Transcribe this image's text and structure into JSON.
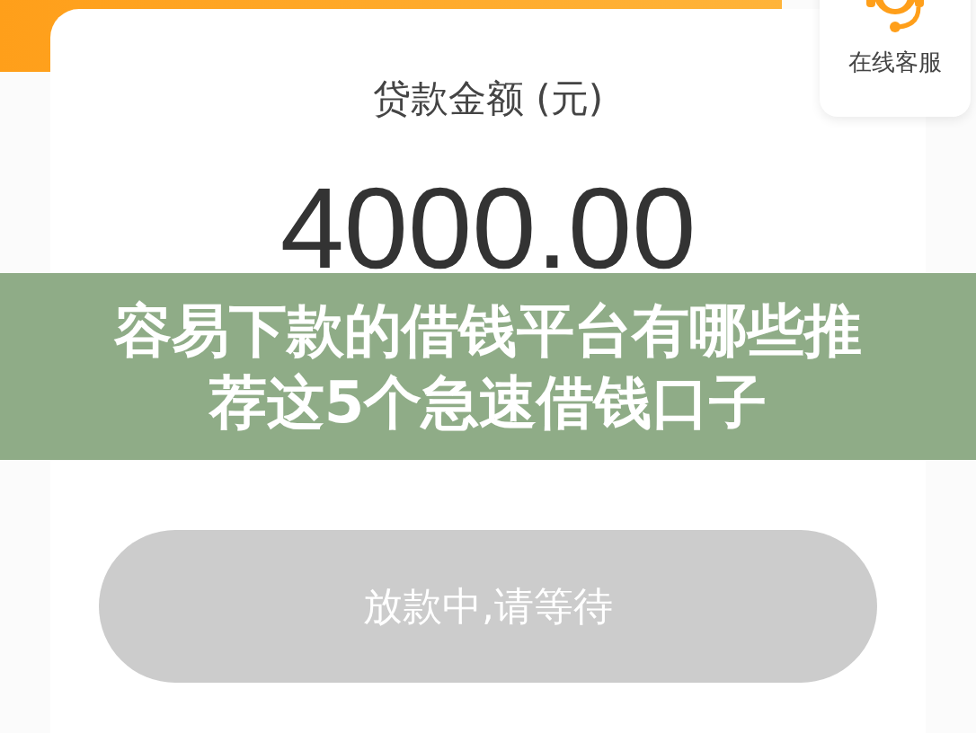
{
  "loan": {
    "label": "贷款金额 (元)",
    "amount": "4000.00"
  },
  "service": {
    "label": "在线客服"
  },
  "banner": {
    "title": "容易下款的借钱平台有哪些推荐这5个急速借钱口子"
  },
  "button": {
    "label": "放款中,请等待",
    "disabled": true
  }
}
